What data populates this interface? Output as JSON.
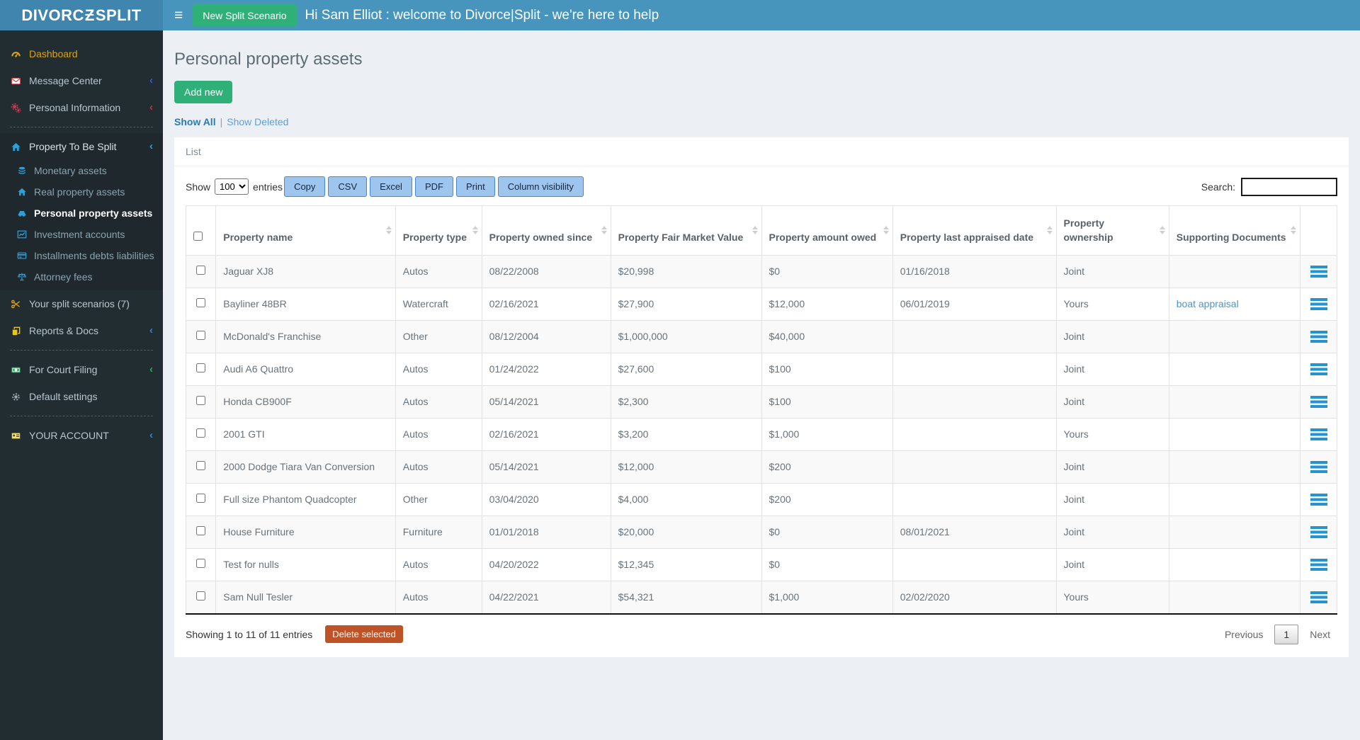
{
  "brand": {
    "left": "DIVORC",
    "mid": "Ƶ",
    "right": "SPLIT"
  },
  "icons": {
    "menu": "≡",
    "chevron": "‹"
  },
  "topbar": {
    "new_split_button": "New Split Scenario",
    "welcome": "Hi Sam Elliot : welcome to Divorce|Split - we're here to help"
  },
  "sidebar": {
    "items": [
      {
        "label": "Dashboard",
        "icon": "gauge-icon"
      },
      {
        "label": "Message Center",
        "icon": "envelope-icon",
        "chevron": "‹"
      },
      {
        "label": "Personal Information",
        "icon": "gears-icon",
        "chevron": "‹"
      },
      {
        "label": "Property To Be Split",
        "icon": "home-icon",
        "chevron": "‹"
      },
      {
        "label": "Your split scenarios (7)",
        "icon": "scissors-icon"
      },
      {
        "label": "Reports & Docs",
        "icon": "copy-icon",
        "chevron": "‹"
      },
      {
        "label": "For Court Filing",
        "icon": "money-bill-icon",
        "chevron": "‹"
      },
      {
        "label": "Default settings",
        "icon": "gear-icon"
      },
      {
        "label": "YOUR ACCOUNT",
        "icon": "id-card-icon",
        "chevron": "‹"
      }
    ],
    "submenu": [
      {
        "label": "Monetary assets",
        "icon": "coins-icon"
      },
      {
        "label": "Real property assets",
        "icon": "home-icon"
      },
      {
        "label": "Personal property assets",
        "icon": "car-icon",
        "active": true
      },
      {
        "label": "Investment accounts",
        "icon": "chart-line-icon"
      },
      {
        "label": "Installments debts liabilities",
        "icon": "credit-card-icon"
      },
      {
        "label": "Attorney fees",
        "icon": "scale-icon"
      }
    ]
  },
  "page": {
    "title": "Personal property assets",
    "add_button": "Add new",
    "show_all": "Show All",
    "separator": "|",
    "show_deleted": "Show Deleted",
    "panel_title": "List"
  },
  "controls": {
    "show_label": "Show",
    "page_size": "100",
    "entries_label": "entries",
    "export_buttons": [
      "Copy",
      "CSV",
      "Excel",
      "PDF",
      "Print",
      "Column visibility"
    ],
    "search_label": "Search:",
    "search_value": ""
  },
  "table": {
    "columns": [
      "Property name",
      "Property type",
      "Property owned since",
      "Property Fair Market Value",
      "Property amount owed",
      "Property last appraised date",
      "Property ownership",
      "Supporting Documents"
    ],
    "rows": [
      {
        "name": "Jaguar XJ8",
        "type": "Autos",
        "owned_since": "08/22/2008",
        "fmv": "$20,998",
        "owed": "$0",
        "appraised": "01/16/2018",
        "ownership": "Joint",
        "docs": ""
      },
      {
        "name": "Bayliner 48BR",
        "type": "Watercraft",
        "owned_since": "02/16/2021",
        "fmv": "$27,900",
        "owed": "$12,000",
        "appraised": "06/01/2019",
        "ownership": "Yours",
        "docs": "boat appraisal"
      },
      {
        "name": "McDonald's Franchise",
        "type": "Other",
        "owned_since": "08/12/2004",
        "fmv": "$1,000,000",
        "owed": "$40,000",
        "appraised": "",
        "ownership": "Joint",
        "docs": ""
      },
      {
        "name": "Audi A6 Quattro",
        "type": "Autos",
        "owned_since": "01/24/2022",
        "fmv": "$27,600",
        "owed": "$100",
        "appraised": "",
        "ownership": "Joint",
        "docs": ""
      },
      {
        "name": "Honda CB900F",
        "type": "Autos",
        "owned_since": "05/14/2021",
        "fmv": "$2,300",
        "owed": "$100",
        "appraised": "",
        "ownership": "Joint",
        "docs": ""
      },
      {
        "name": "2001 GTI",
        "type": "Autos",
        "owned_since": "02/16/2021",
        "fmv": "$3,200",
        "owed": "$1,000",
        "appraised": "",
        "ownership": "Yours",
        "docs": ""
      },
      {
        "name": "2000 Dodge Tiara Van Conversion",
        "type": "Autos",
        "owned_since": "05/14/2021",
        "fmv": "$12,000",
        "owed": "$200",
        "appraised": "",
        "ownership": "Joint",
        "docs": ""
      },
      {
        "name": "Full size Phantom Quadcopter",
        "type": "Other",
        "owned_since": "03/04/2020",
        "fmv": "$4,000",
        "owed": "$200",
        "appraised": "",
        "ownership": "Joint",
        "docs": ""
      },
      {
        "name": "House Furniture",
        "type": "Furniture",
        "owned_since": "01/01/2018",
        "fmv": "$20,000",
        "owed": "$0",
        "appraised": "08/01/2021",
        "ownership": "Joint",
        "docs": ""
      },
      {
        "name": "Test for nulls",
        "type": "Autos",
        "owned_since": "04/20/2022",
        "fmv": "$12,345",
        "owed": "$0",
        "appraised": "",
        "ownership": "Joint",
        "docs": ""
      },
      {
        "name": "Sam Null Tesler",
        "type": "Autos",
        "owned_since": "04/22/2021",
        "fmv": "$54,321",
        "owed": "$1,000",
        "appraised": "02/02/2020",
        "ownership": "Yours",
        "docs": ""
      }
    ]
  },
  "footer": {
    "summary": "Showing 1 to 11 of 11 entries",
    "delete_button": "Delete selected",
    "previous_label": "Previous",
    "page_number": "1",
    "next_label": "Next"
  },
  "colors": {
    "topbar": "#4795bd",
    "brand_bg": "#3f85ad",
    "sidebar": "#222d32",
    "accent_green": "#2fb079",
    "export_button": "#9ec5ee",
    "export_border": "#4288cd",
    "link_blue": "#4796d2",
    "delete_red": "#bd5327",
    "row_menu_blue": "#2793ce",
    "page_bg": "#ecf0f5"
  }
}
